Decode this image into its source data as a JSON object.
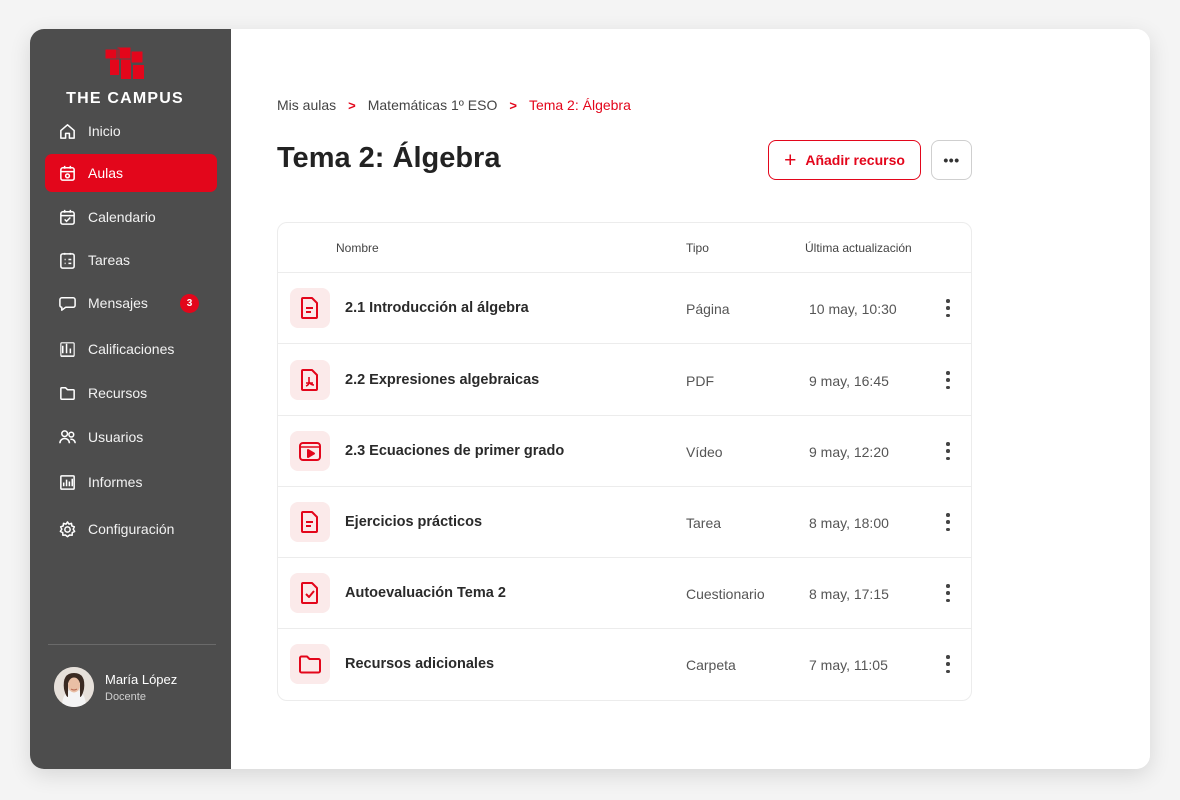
{
  "brand": {
    "name": "THE CAMPUS",
    "accent": "#e3061b",
    "sidebar_bg": "#4d4d4d"
  },
  "sidebar": {
    "items": [
      {
        "label": "Inicio",
        "icon": "home-icon"
      },
      {
        "label": "Aulas",
        "icon": "classroom-icon",
        "active": true
      },
      {
        "label": "Calendario",
        "icon": "calendar-icon"
      },
      {
        "label": "Tareas",
        "icon": "tasks-icon"
      },
      {
        "label": "Mensajes",
        "icon": "message-icon",
        "badge": "3"
      },
      {
        "label": "Calificaciones",
        "icon": "grades-icon"
      },
      {
        "label": "Recursos",
        "icon": "folder-icon"
      },
      {
        "label": "Usuarios",
        "icon": "users-icon"
      },
      {
        "label": "Informes",
        "icon": "reports-icon"
      },
      {
        "label": "Configuración",
        "icon": "gear-icon"
      }
    ],
    "user": {
      "name": "María López",
      "role": "Docente"
    }
  },
  "breadcrumb": {
    "items": [
      "Mis aulas",
      "Matemáticas 1º ESO",
      "Tema 2: Álgebra"
    ],
    "separator": ">"
  },
  "page": {
    "title": "Tema 2: Álgebra",
    "add_button": "Añadir recurso",
    "more_button": "•••"
  },
  "table": {
    "columns": {
      "name": "Nombre",
      "type": "Tipo",
      "updated": "Última actualización"
    },
    "rows": [
      {
        "name": "2.1 Introducción al álgebra",
        "type": "Página",
        "updated": "10 may, 10:30",
        "icon": "page-file-icon"
      },
      {
        "name": "2.2 Expresiones algebraicas",
        "type": "PDF",
        "updated": "9 may, 16:45",
        "icon": "pdf-file-icon"
      },
      {
        "name": "2.3 Ecuaciones de primer grado",
        "type": "Vídeo",
        "updated": "9 may, 12:20",
        "icon": "video-icon"
      },
      {
        "name": "Ejercicios prácticos",
        "type": "Tarea",
        "updated": "8 may, 18:00",
        "icon": "task-file-icon"
      },
      {
        "name": "Autoevaluación Tema 2",
        "type": "Cuestionario",
        "updated": "8 may, 17:15",
        "icon": "quiz-file-icon"
      },
      {
        "name": "Recursos adicionales",
        "type": "Carpeta",
        "updated": "7 may, 11:05",
        "icon": "folder-icon"
      }
    ]
  }
}
